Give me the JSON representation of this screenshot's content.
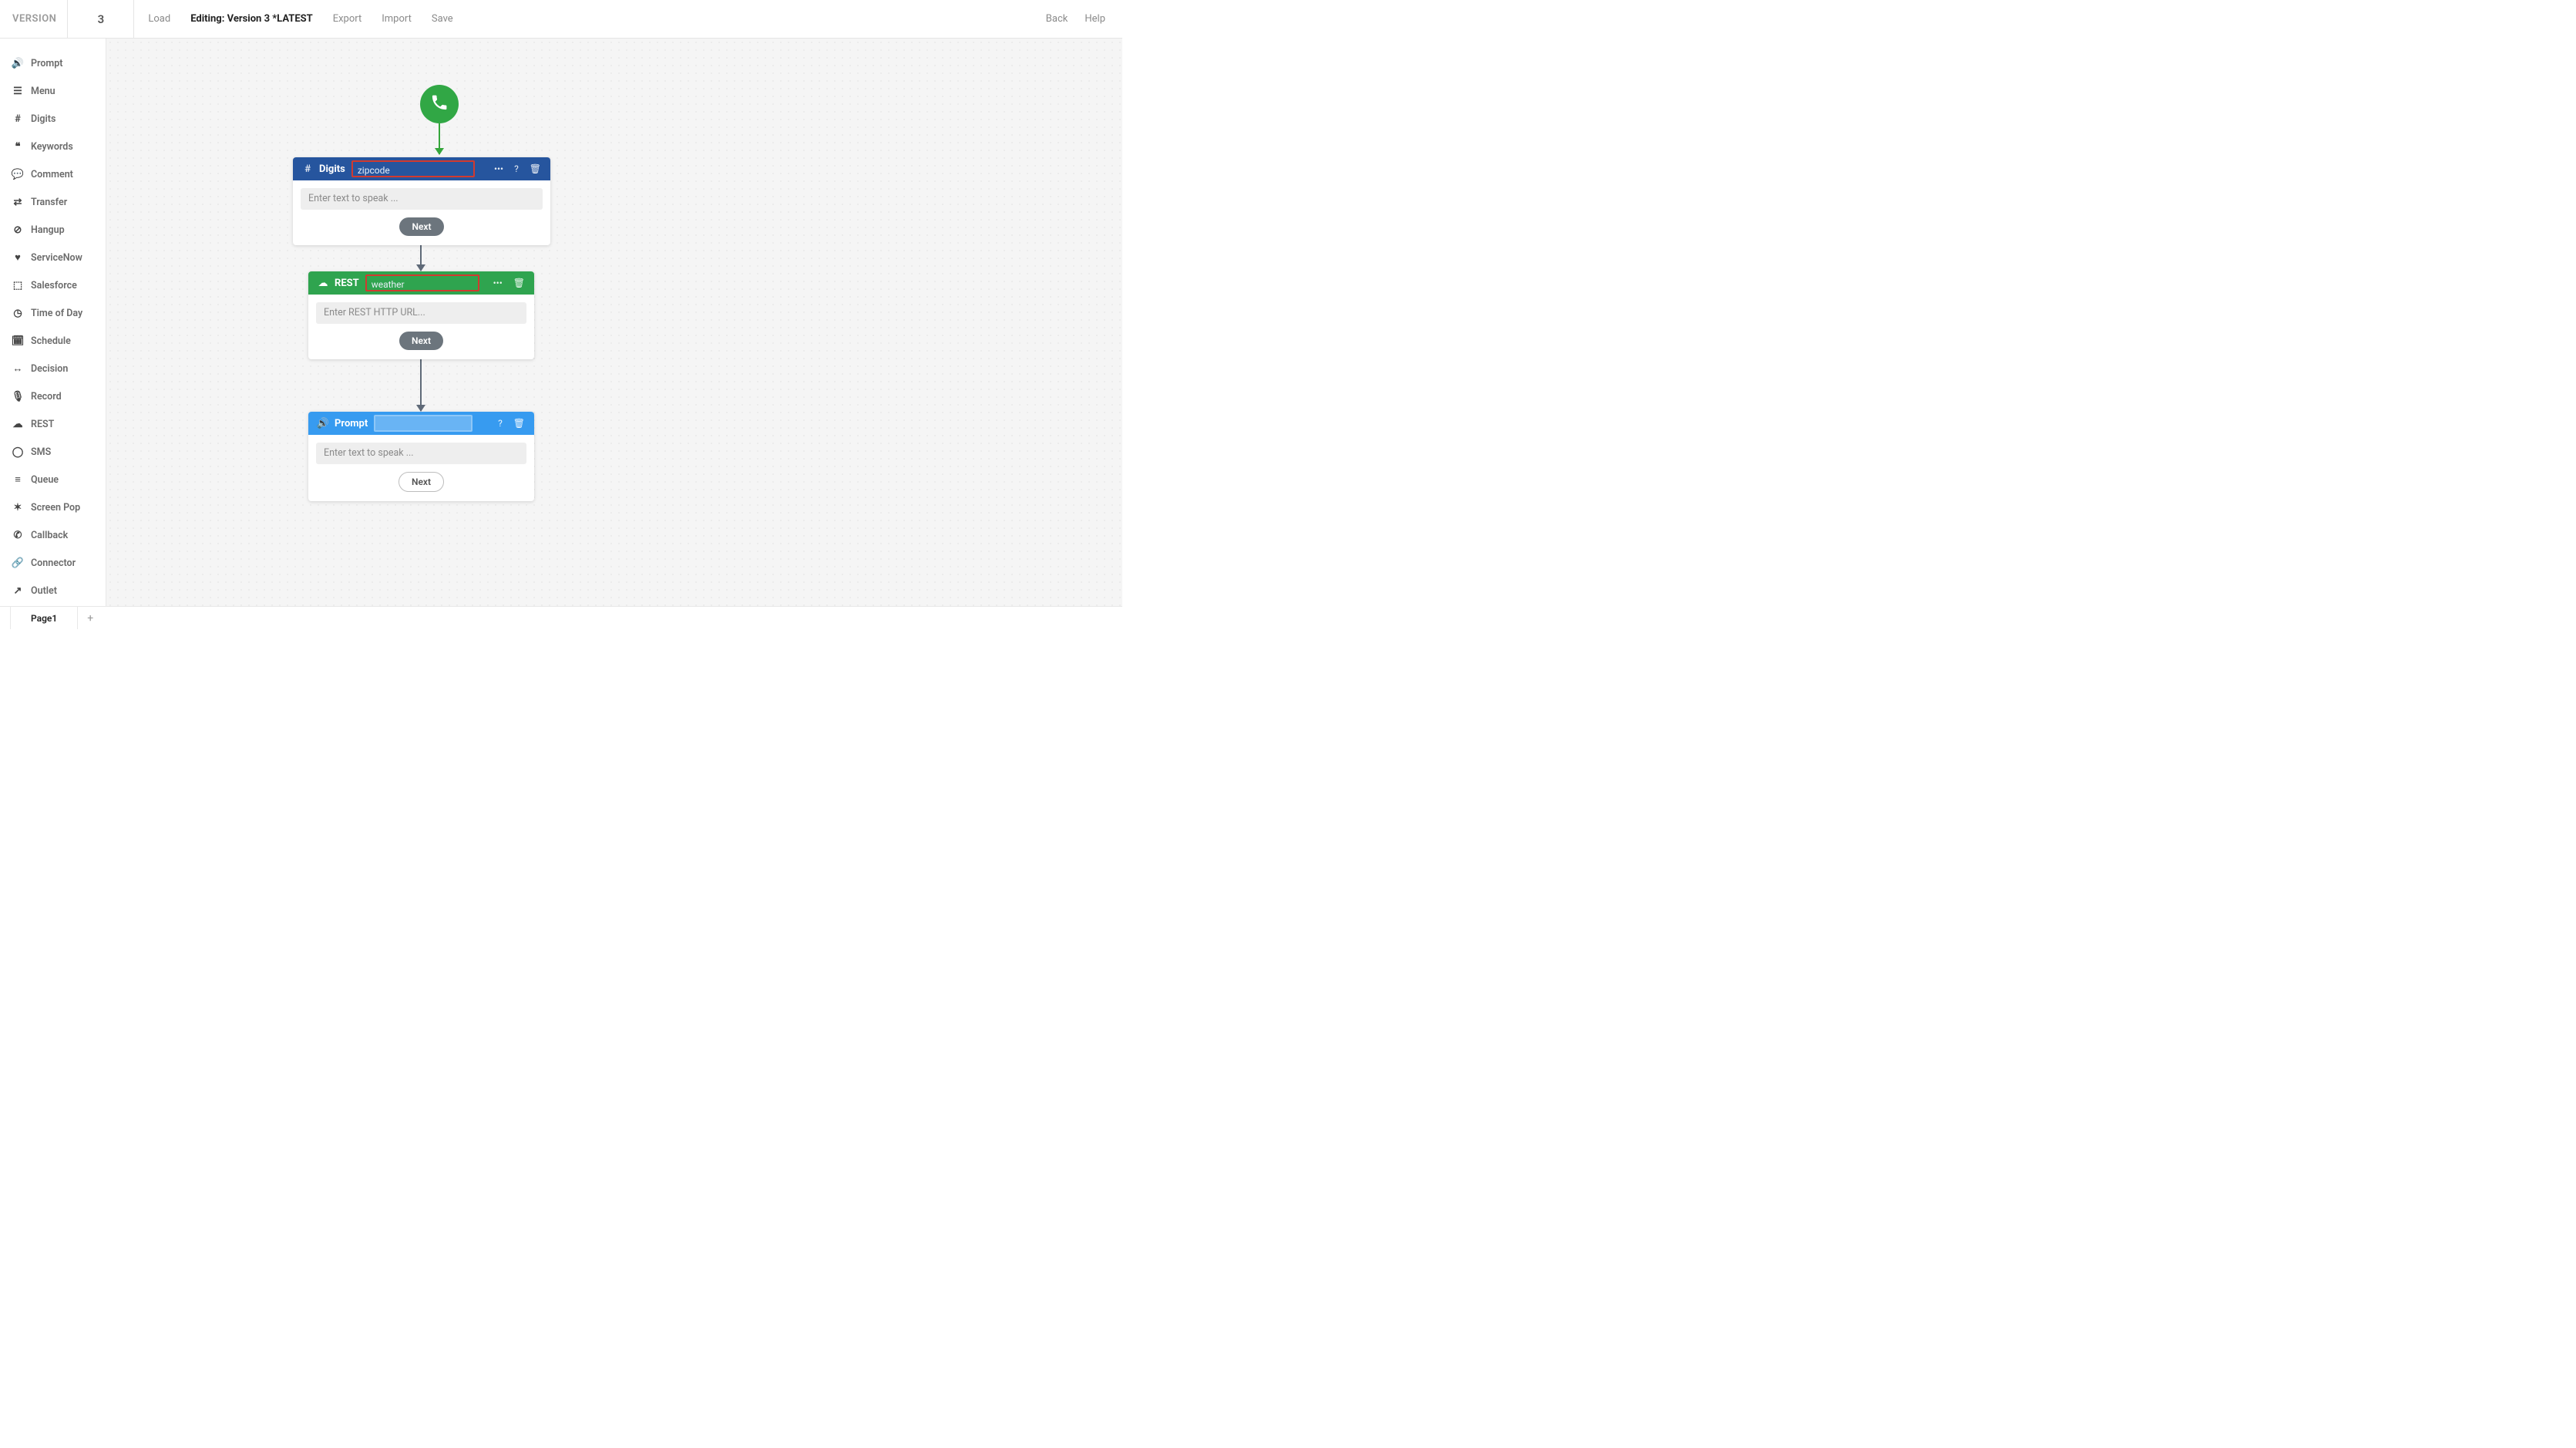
{
  "header": {
    "version_label": "VERSION",
    "version_number": "3",
    "load": "Load",
    "editing": "Editing: Version 3 *LATEST",
    "export": "Export",
    "import_": "Import",
    "save": "Save",
    "back": "Back",
    "help": "Help"
  },
  "palette": [
    {
      "icon": "🔊",
      "label": "Prompt"
    },
    {
      "icon": "☰",
      "label": "Menu"
    },
    {
      "icon": "#",
      "label": "Digits"
    },
    {
      "icon": "❝",
      "label": "Keywords"
    },
    {
      "icon": "💬",
      "label": "Comment"
    },
    {
      "icon": "⇄",
      "label": "Transfer"
    },
    {
      "icon": "⊘",
      "label": "Hangup"
    },
    {
      "icon": "♥",
      "label": "ServiceNow"
    },
    {
      "icon": "⬚",
      "label": "Salesforce"
    },
    {
      "icon": "◷",
      "label": "Time of Day"
    },
    {
      "icon": "🗓",
      "label": "Schedule"
    },
    {
      "icon": "↔",
      "label": "Decision"
    },
    {
      "icon": "🎙",
      "label": "Record"
    },
    {
      "icon": "☁",
      "label": "REST"
    },
    {
      "icon": "◯",
      "label": "SMS"
    },
    {
      "icon": "≡",
      "label": "Queue"
    },
    {
      "icon": "✶",
      "label": "Screen Pop"
    },
    {
      "icon": "✆",
      "label": "Callback"
    },
    {
      "icon": "🔗",
      "label": "Connector"
    },
    {
      "icon": "↗",
      "label": "Outlet"
    }
  ],
  "nodes": {
    "digits": {
      "title": "Digits",
      "name": "zipcode",
      "placeholder": "Enter text to speak ...",
      "next": "Next"
    },
    "rest": {
      "title": "REST",
      "name": "weather",
      "placeholder": "Enter REST HTTP URL...",
      "next": "Next"
    },
    "prompt": {
      "title": "Prompt",
      "name": "",
      "placeholder": "Enter text to speak ...",
      "next": "Next"
    }
  },
  "actions": {
    "more": "•••",
    "help": "?",
    "trash": "🗑"
  },
  "bottom": {
    "page": "Page1",
    "add": "+"
  }
}
